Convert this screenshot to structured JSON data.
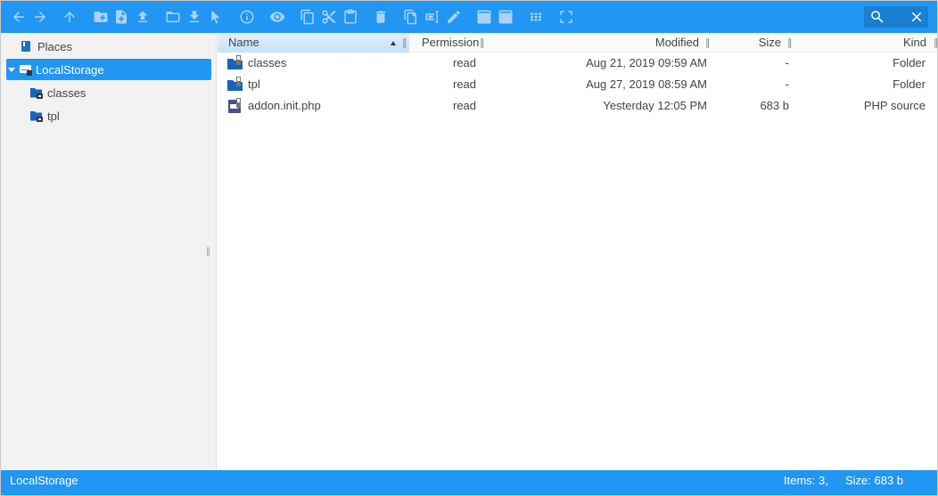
{
  "colors": {
    "accent": "#2196f3",
    "folder": "#1565c0",
    "lock": "#555555"
  },
  "toolbar": {
    "buttons": [
      {
        "name": "back-arrow-icon"
      },
      {
        "name": "forward-arrow-icon"
      },
      {
        "name": "up-arrow-icon"
      },
      {
        "name": "new-folder-icon"
      },
      {
        "name": "new-file-icon"
      },
      {
        "name": "upload-icon"
      },
      {
        "name": "open-folder-icon"
      },
      {
        "name": "download-icon"
      },
      {
        "name": "select-pointer-icon"
      },
      {
        "name": "info-icon"
      },
      {
        "name": "preview-eye-icon"
      },
      {
        "name": "copy-icon"
      },
      {
        "name": "cut-icon"
      },
      {
        "name": "paste-icon"
      },
      {
        "name": "delete-icon"
      },
      {
        "name": "duplicate-icon"
      },
      {
        "name": "rename-icon"
      },
      {
        "name": "edit-pencil-icon"
      },
      {
        "name": "archive-icon"
      },
      {
        "name": "extract-icon"
      },
      {
        "name": "grid-view-icon"
      },
      {
        "name": "fullscreen-icon"
      }
    ],
    "search": {
      "placeholder": "",
      "value": ""
    }
  },
  "navbar": {
    "places_label": "Places",
    "root_label": "LocalStorage",
    "children": [
      {
        "label": "classes"
      },
      {
        "label": "tpl"
      }
    ]
  },
  "table": {
    "columns": {
      "name": "Name",
      "permission": "Permission",
      "modified": "Modified",
      "size": "Size",
      "kind": "Kind"
    },
    "sort_column": "name",
    "sort_direction": "asc",
    "rows": [
      {
        "name": "classes",
        "permission": "read",
        "modified": "Aug 21, 2019 09:59 AM",
        "size": "-",
        "kind": "Folder",
        "type": "folder"
      },
      {
        "name": "tpl",
        "permission": "read",
        "modified": "Aug 27, 2019 08:59 AM",
        "size": "-",
        "kind": "Folder",
        "type": "folder"
      },
      {
        "name": "addon.init.php",
        "permission": "read",
        "modified": "Yesterday 12:05 PM",
        "size": "683 b",
        "kind": "PHP source",
        "type": "php"
      }
    ]
  },
  "status": {
    "path": "LocalStorage",
    "items": "Items: 3,",
    "size": "Size: 683 b"
  }
}
